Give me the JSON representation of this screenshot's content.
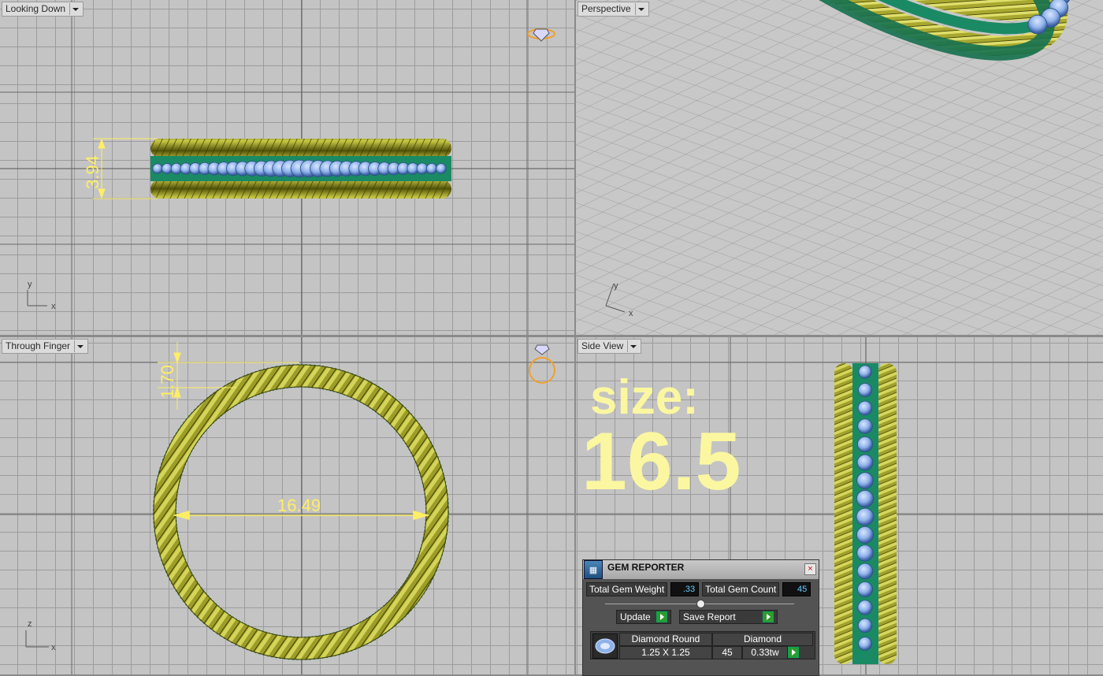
{
  "viewports": {
    "top_left": {
      "label": "Looking Down",
      "axis_x": "x",
      "axis_y": "y",
      "dimension": "3.94"
    },
    "top_right": {
      "label": "Perspective",
      "axis_x": "x",
      "axis_y": "y"
    },
    "bottom_left": {
      "label": "Through Finger",
      "axis_x": "x",
      "axis_z": "z",
      "dimension_top": "1.70",
      "dimension_inner": "16.49"
    },
    "bottom_right": {
      "label": "Side View"
    }
  },
  "overlay": {
    "size_word": "size:",
    "size_value": "16.5"
  },
  "gem_reporter": {
    "title": "GEM REPORTER",
    "close": "×",
    "total_weight_label": "Total Gem Weight",
    "total_weight_value": ".33",
    "total_count_label": "Total Gem Count",
    "total_count_value": "45",
    "slider_level": 0.5,
    "update_label": "Update",
    "save_label": "Save Report",
    "gem": {
      "shape": "Diamond Round",
      "type": "Diamond",
      "size": "1.25 X 1.25",
      "count": "45",
      "weight": "0.33tw"
    }
  },
  "colors": {
    "metal": "#8a8a1e",
    "metal_light": "#c8c845",
    "gem": "#8fb2ea",
    "setting": "#1a8a64",
    "dimension": "#ffee66",
    "size_text": "#fbf7a0"
  },
  "icons": [
    "viewport-dropdown-icon",
    "diamond-view-icon",
    "ring-view-icon",
    "gem-reporter-logo-icon",
    "close-icon",
    "play-icon",
    "round-diamond-icon"
  ]
}
